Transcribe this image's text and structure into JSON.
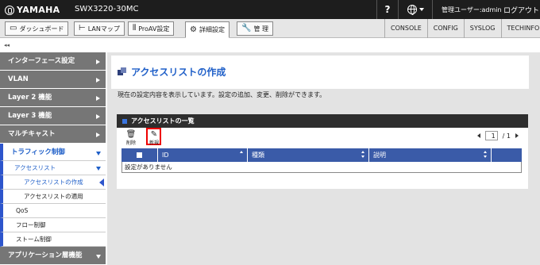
{
  "header": {
    "brand": "YAMAHA",
    "model": "SWX3220-30MC",
    "help": "?",
    "user": "管理ユーザー:admin",
    "logout": "ログアウト"
  },
  "nav": {
    "tabs": [
      {
        "label": "ダッシュボード",
        "icon": "dashboard-icon",
        "glyph": "▭"
      },
      {
        "label": "LANマップ",
        "icon": "lan-map-icon",
        "glyph": "⊢"
      },
      {
        "label": "ProAV設定",
        "icon": "proav-icon",
        "glyph": "⫴"
      },
      {
        "label": "詳細設定",
        "icon": "gear-icon",
        "glyph": "⚙"
      },
      {
        "label": "管 理",
        "icon": "wrench-icon",
        "glyph": "🔧"
      }
    ],
    "links": [
      "CONSOLE",
      "CONFIG",
      "SYSLOG",
      "TECHINFO"
    ],
    "collapse": "◂◂"
  },
  "sidebar": {
    "interface": "インターフェース設定",
    "vlan": "VLAN",
    "layer2": "Layer 2 機能",
    "layer3": "Layer 3 機能",
    "multicast": "マルチキャスト",
    "traffic": "トラフィック制御",
    "access_list": "アクセスリスト",
    "access_create": "アクセスリストの作成",
    "access_apply": "アクセスリストの適用",
    "qos": "QoS",
    "flow": "フロー制御",
    "storm": "ストーム制御",
    "app_features": "アプリケーション層機能"
  },
  "main": {
    "title": "アクセスリストの作成",
    "description": "現在の設定内容を表示しています。設定の追加、変更、削除ができます。",
    "list_title": "アクセスリストの一覧",
    "delete_label": "削除",
    "new_label": "新規",
    "pager": {
      "current": "1",
      "total": "/ 1"
    },
    "columns": [
      "ID",
      "種類",
      "説明"
    ],
    "empty_text": "設定がありません"
  },
  "colors": {
    "accent": "#1f5fc8",
    "header_bg": "#1d1d1d",
    "table_head": "#3a5ba8",
    "highlight": "#e00000"
  }
}
